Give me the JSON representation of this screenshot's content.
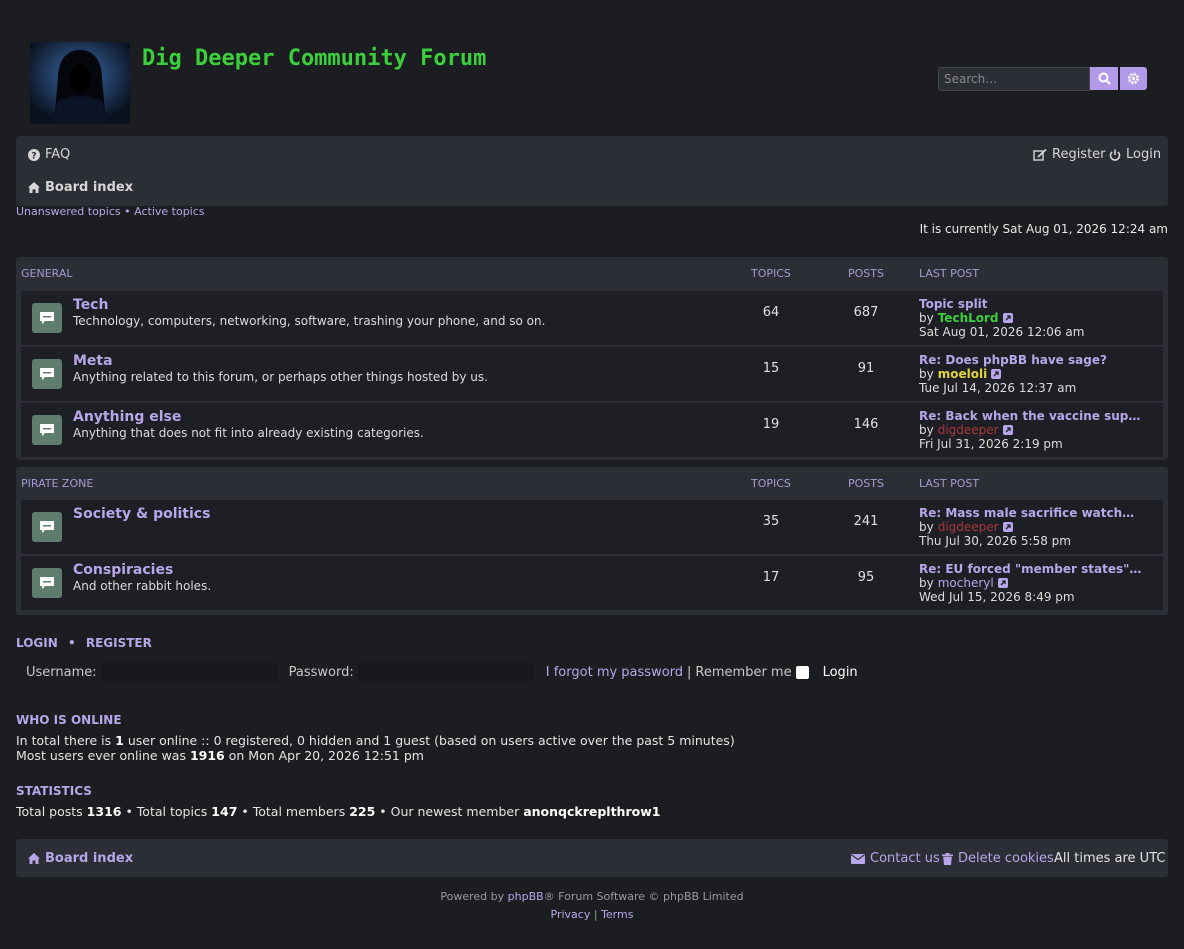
{
  "header": {
    "site_title": "Dig Deeper Community Forum",
    "search_placeholder": "Search…"
  },
  "navbar": {
    "faq": "FAQ",
    "register": "Register",
    "login": "Login",
    "board_index": "Board index"
  },
  "quicklinks": {
    "unanswered": "Unanswered topics",
    "separator": "•",
    "active": "Active topics"
  },
  "current_time": "It is currently Sat Aug 01, 2026 12:24 am",
  "columns": {
    "topics": "TOPICS",
    "posts": "POSTS",
    "last_post": "LAST POST"
  },
  "categories": [
    {
      "name": "GENERAL",
      "forums": [
        {
          "title": "Tech",
          "description": "Technology, computers, networking, software, trashing your phone, and so on.",
          "topics": "64",
          "posts": "687",
          "last_post_title": "Topic split",
          "by": "by",
          "author": "TechLord",
          "author_color": "#3ccf3c",
          "date": "Sat Aug 01, 2026 12:06 am"
        },
        {
          "title": "Meta",
          "description": "Anything related to this forum, or perhaps other things hosted by us.",
          "topics": "15",
          "posts": "91",
          "last_post_title": "Re: Does phpBB have sage?",
          "by": "by",
          "author": "moeloli",
          "author_color": "#e2d53a",
          "date": "Tue Jul 14, 2026 12:37 am"
        },
        {
          "title": "Anything else",
          "description": "Anything that does not fit into already existing categories.",
          "topics": "19",
          "posts": "146",
          "last_post_title": "Re: Back when the vaccine sup…",
          "by": "by",
          "author": "digdeeper",
          "author_color": "#a8373d",
          "date": "Fri Jul 31, 2026 2:19 pm"
        }
      ]
    },
    {
      "name": "PIRATE ZONE",
      "forums": [
        {
          "title": "Society & politics",
          "description": "",
          "topics": "35",
          "posts": "241",
          "last_post_title": "Re: Mass male sacrifice watch…",
          "by": "by",
          "author": "digdeeper",
          "author_color": "#a8373d",
          "date": "Thu Jul 30, 2026 5:58 pm"
        },
        {
          "title": "Conspiracies",
          "description": "And other rabbit holes.",
          "topics": "17",
          "posts": "95",
          "last_post_title": "Re: EU forced \"member states\"…",
          "by": "by",
          "author": "mocheryl",
          "author_color": "#b7a7ea",
          "date": "Wed Jul 15, 2026 8:49 pm"
        }
      ]
    }
  ],
  "login_box": {
    "login_link": "LOGIN",
    "bullet": "•",
    "register_link": "REGISTER",
    "username_label": "Username:",
    "password_label": "Password:",
    "forgot": "I forgot my password",
    "pipe": "|",
    "remember": "Remember me",
    "login_button": "Login"
  },
  "who_is_online": {
    "heading": "WHO IS ONLINE",
    "line1_a": "In total there is",
    "line1_count": "1",
    "line1_b": "user online :: 0 registered, 0 hidden and 1 guest (based on users active over the past 5 minutes)",
    "line2_a": "Most users ever online was",
    "line2_count": "1916",
    "line2_b": "on Mon Apr 20, 2026 12:51 pm"
  },
  "statistics": {
    "heading": "STATISTICS",
    "total_posts_label": "Total posts",
    "total_posts": "1316",
    "total_topics_label": "• Total topics",
    "total_topics": "147",
    "total_members_label": "• Total members",
    "total_members": "225",
    "newest_label": "• Our newest member",
    "newest_member": "anonqckreplthrow1"
  },
  "footer": {
    "board_index": "Board index",
    "contact": "Contact us",
    "delete_cookies": "Delete cookies",
    "timezone": "All times are UTC",
    "powered_a": "Powered by",
    "phpbb": "phpBB",
    "powered_b": "® Forum Software © phpBB Limited",
    "privacy": "Privacy",
    "pipe": "|",
    "terms": "Terms"
  }
}
